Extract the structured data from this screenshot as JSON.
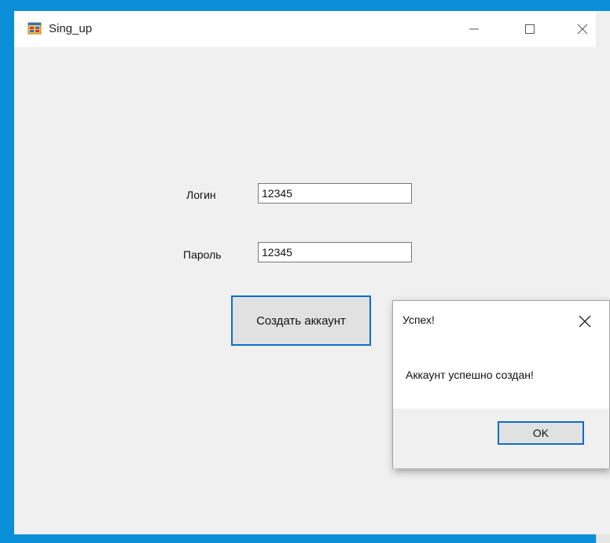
{
  "window": {
    "title": "Sing_up",
    "icon": "app-form-icon",
    "controls": [
      "minimize-icon",
      "maximize-icon",
      "close-icon"
    ]
  },
  "form": {
    "login_label": "Логин",
    "login_value": "12345",
    "password_label": "Пароль",
    "password_value": "12345",
    "create_button": "Создать аккаунт"
  },
  "dialog": {
    "title": "Успех!",
    "message": "Аккаунт успешно создан!",
    "ok_button": "OK"
  },
  "colors": {
    "desktop": "#0a8fd8",
    "window_bg": "#f0f0f0",
    "focus_border": "#0b6fc7"
  }
}
